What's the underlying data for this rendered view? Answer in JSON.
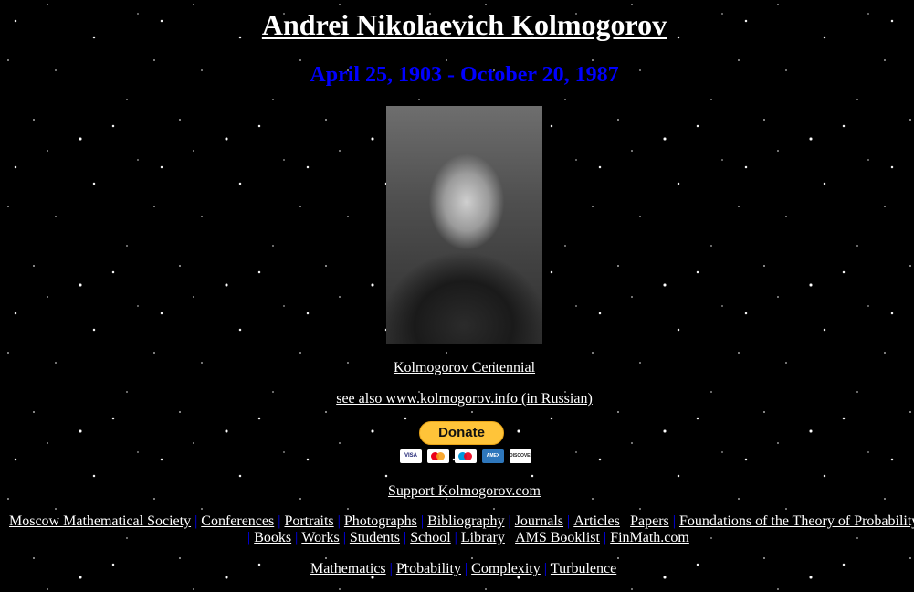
{
  "title": "Andrei Nikolaevich Kolmogorov",
  "dates": "April 25, 1903 - October 20, 1987",
  "links": {
    "centennial": "Kolmogorov Centennial",
    "see_also": "see also www.kolmogorov.info (in Russian)",
    "support": "Support Kolmogorov.com"
  },
  "donate": {
    "label": "Donate",
    "cards": [
      "VISA",
      "mastercard",
      "maestro",
      "AMERICAN EXPRESS",
      "DISCOVER"
    ]
  },
  "nav": {
    "separator": "|",
    "row1": [
      "Moscow Mathematical Society",
      "Conferences",
      "Portraits",
      "Photographs",
      "Bibliography",
      "Journals",
      "Articles",
      "Papers",
      "Foundations of the Theory of Probability"
    ],
    "row2": [
      "Books",
      "Works",
      "Students",
      "School",
      "Library",
      "AMS Booklist",
      "FinMath.com"
    ],
    "row3": [
      "Mathematics",
      "Probability",
      "Complexity",
      "Turbulence"
    ]
  }
}
